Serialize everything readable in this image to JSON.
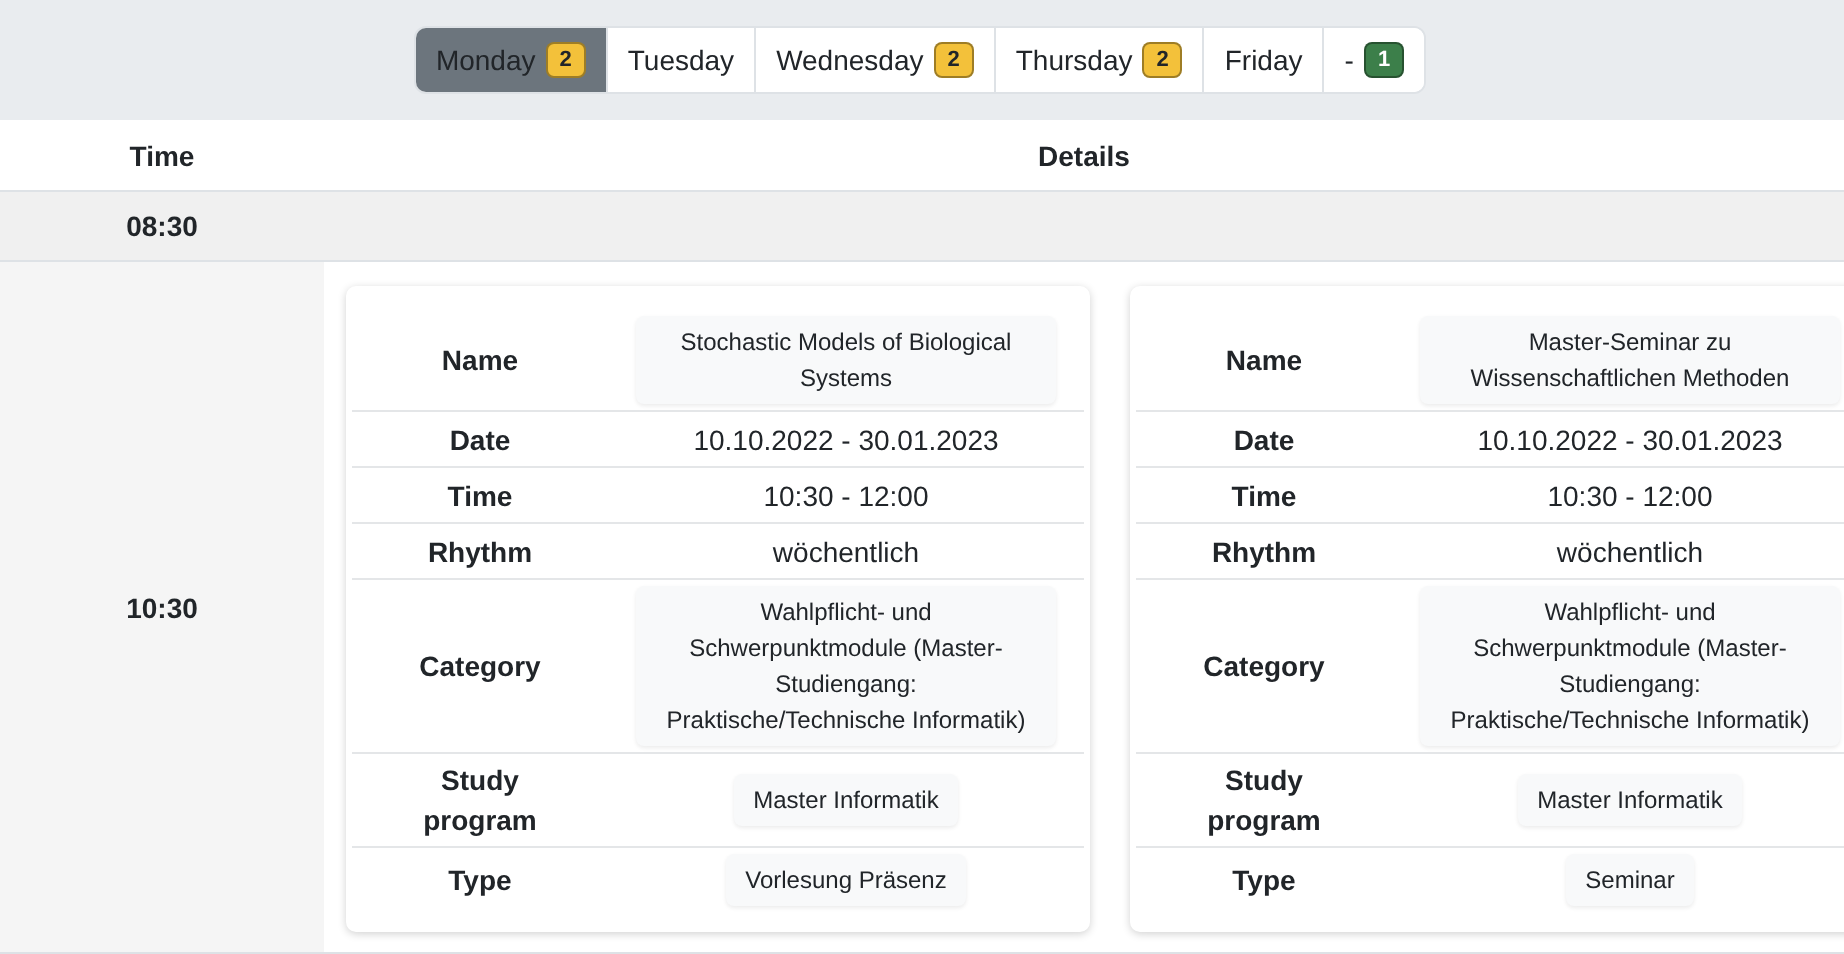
{
  "tabs": [
    {
      "label": "Monday",
      "selected": true,
      "badge": {
        "count": "2",
        "color": "#f3c13a"
      }
    },
    {
      "label": "Tuesday",
      "selected": false
    },
    {
      "label": "Wednesday",
      "selected": false,
      "badge": {
        "count": "2",
        "color": "#f3c13a"
      }
    },
    {
      "label": "Thursday",
      "selected": false,
      "badge": {
        "count": "2",
        "color": "#f3c13a"
      }
    },
    {
      "label": "Friday",
      "selected": false
    },
    {
      "label": "-",
      "selected": false,
      "badge": {
        "count": "1",
        "color": "#3c7f4a"
      }
    }
  ],
  "table": {
    "columns": [
      "Time",
      "Details"
    ],
    "rows": [
      {
        "time": "08:30",
        "events": []
      },
      {
        "time": "10:30",
        "events": [
          {
            "fields": [
              {
                "label": "Name",
                "value": "Stochastic Models of Biological Systems",
                "kind": "chip"
              },
              {
                "label": "Date",
                "value": "10.10.2022 - 30.01.2023",
                "kind": "text"
              },
              {
                "label": "Time",
                "value": "10:30 - 12:00",
                "kind": "text"
              },
              {
                "label": "Rhythm",
                "value": "wöchentlich",
                "kind": "text"
              },
              {
                "label": "Category",
                "value": "Wahlpflicht- und Schwerpunktmodule (Master-Studiengang: Praktische/Technische Informatik)",
                "kind": "chip"
              },
              {
                "label": "Study program",
                "value": "Master Informatik",
                "kind": "chip"
              },
              {
                "label": "Type",
                "value": "Vorlesung Präsenz",
                "kind": "chip"
              }
            ]
          },
          {
            "fields": [
              {
                "label": "Name",
                "value": "Master-Seminar zu Wissenschaftlichen Methoden",
                "kind": "chip"
              },
              {
                "label": "Date",
                "value": "10.10.2022 - 30.01.2023",
                "kind": "text"
              },
              {
                "label": "Time",
                "value": "10:30 - 12:00",
                "kind": "text"
              },
              {
                "label": "Rhythm",
                "value": "wöchentlich",
                "kind": "text"
              },
              {
                "label": "Category",
                "value": "Wahlpflicht- und Schwerpunktmodule (Master-Studiengang: Praktische/Technische Informatik)",
                "kind": "chip"
              },
              {
                "label": "Study program",
                "value": "Master Informatik",
                "kind": "chip"
              },
              {
                "label": "Type",
                "value": "Seminar",
                "kind": "chip"
              }
            ]
          }
        ]
      }
    ]
  }
}
